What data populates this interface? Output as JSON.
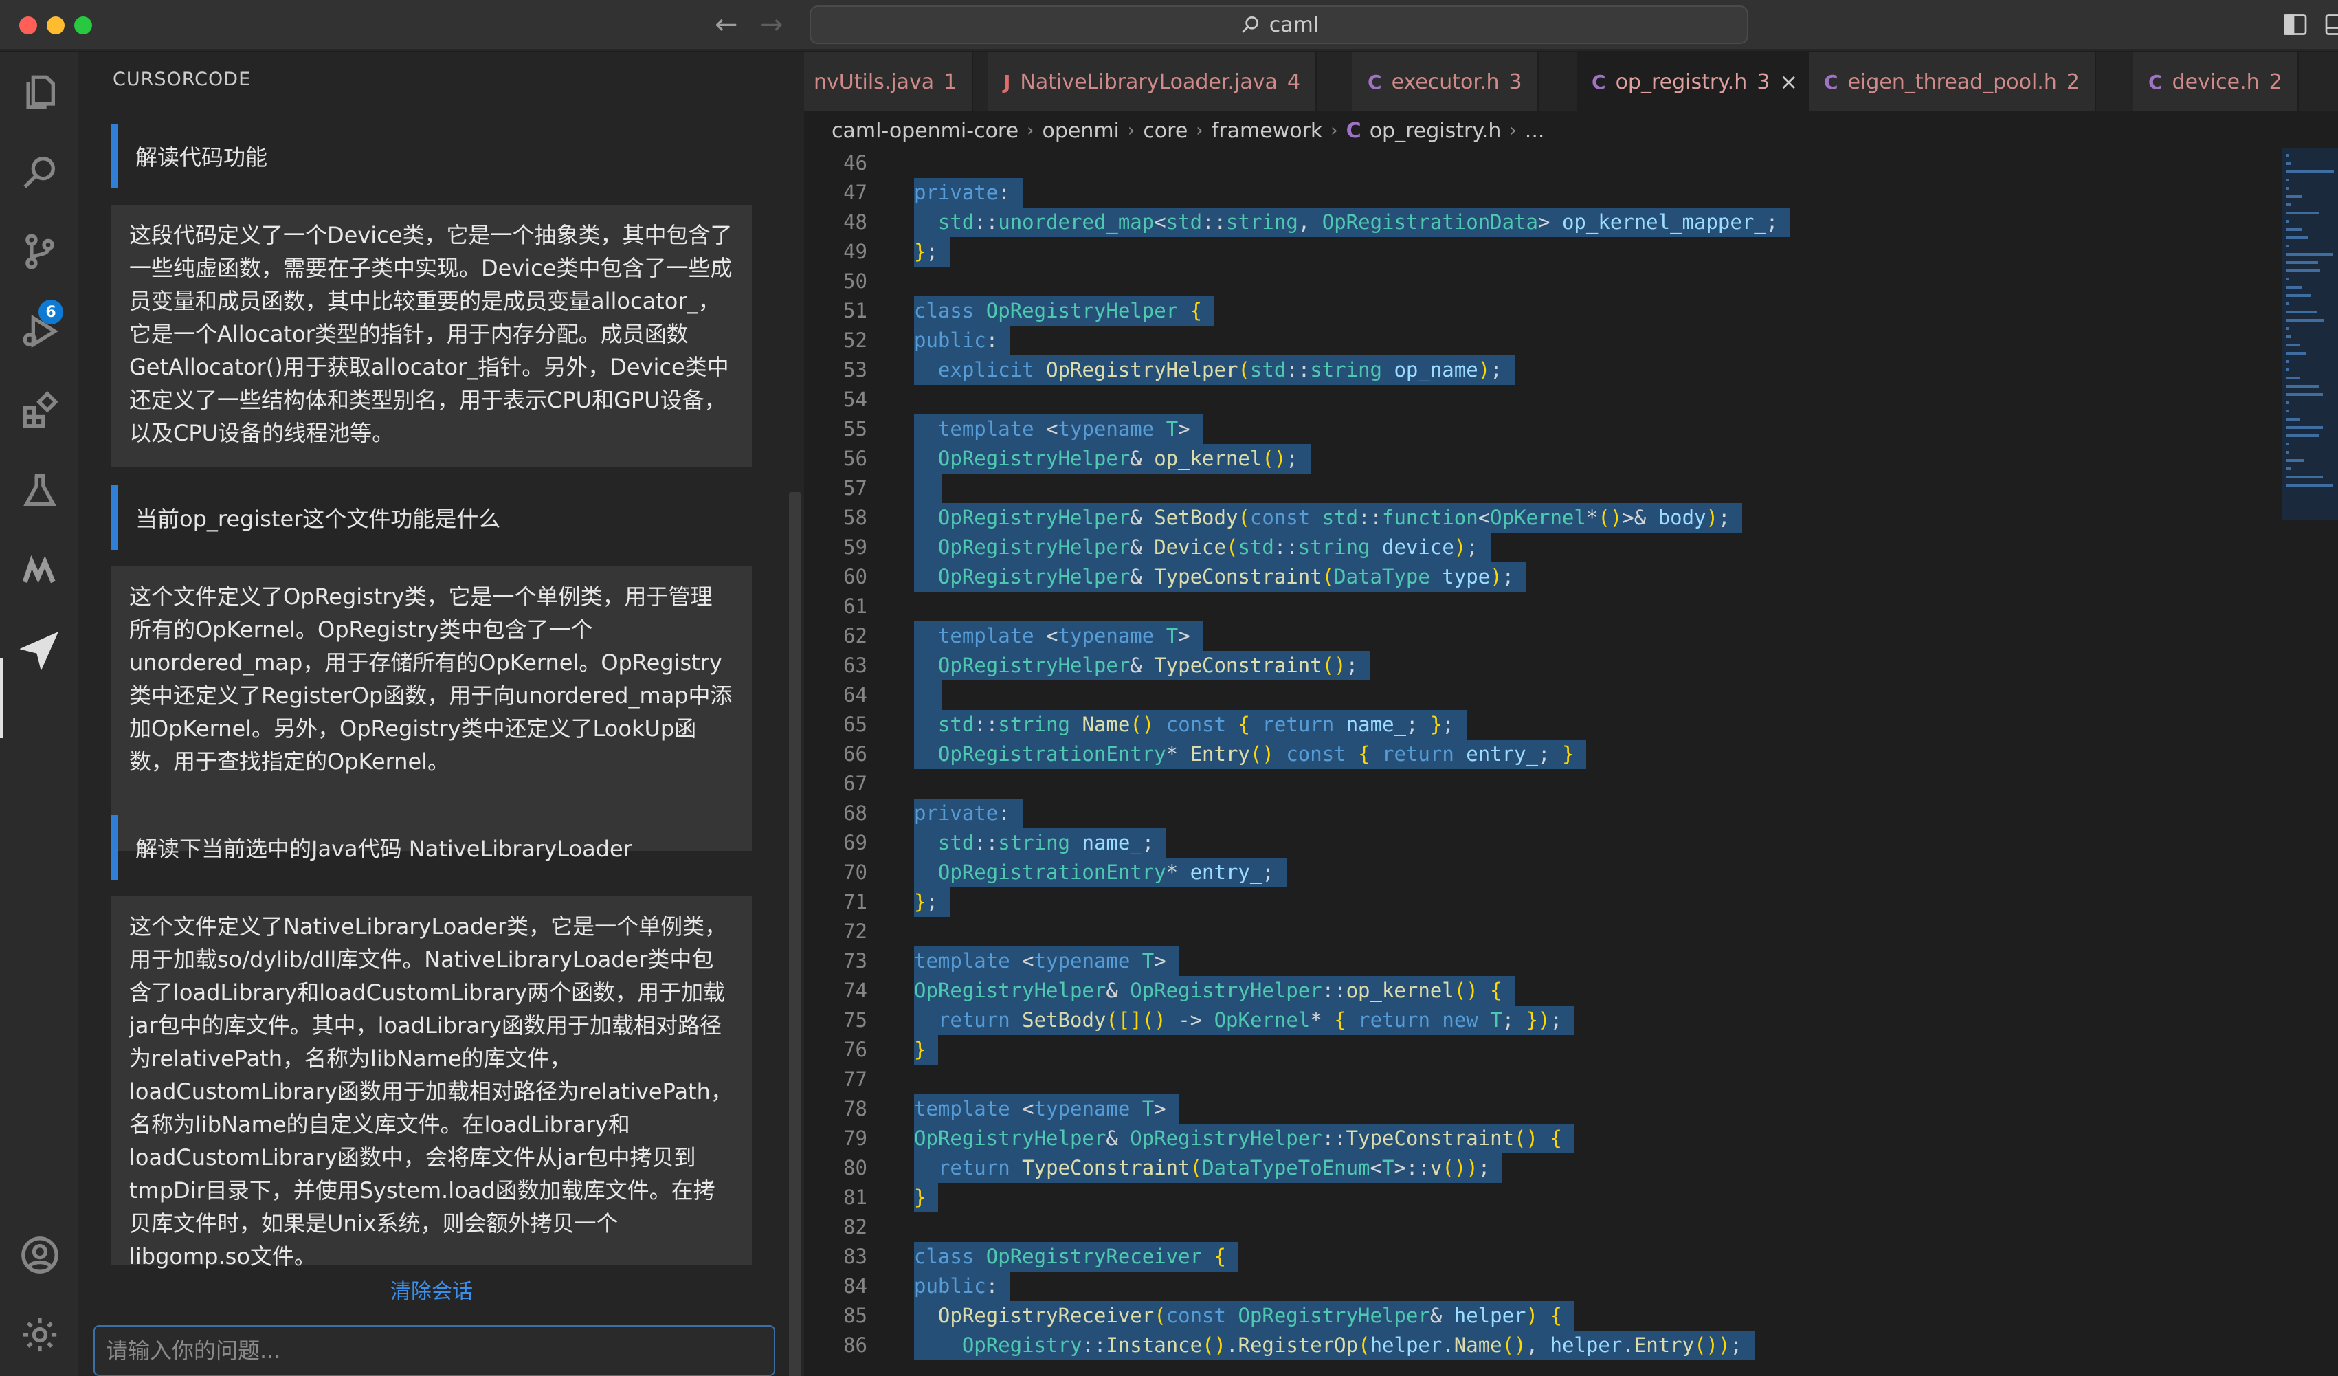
{
  "titlebar": {
    "search_text": "caml"
  },
  "activitybar": {
    "scm_badge": "6"
  },
  "sidebar": {
    "title": "CURSORCODE",
    "conversation": [
      {
        "question": "解读代码功能",
        "answer": "这段代码定义了一个Device类，它是一个抽象类，其中包含了一些纯虚函数，需要在子类中实现。Device类中包含了一些成员变量和成员函数，其中比较重要的是成员变量allocator_，它是一个Allocator类型的指针，用于内存分配。成员函数GetAllocator()用于获取allocator_指针。另外，Device类中还定义了一些结构体和类型别名，用于表示CPU和GPU设备，以及CPU设备的线程池等。"
      },
      {
        "question": "当前op_register这个文件功能是什么",
        "answer": "这个文件定义了OpRegistry类，它是一个单例类，用于管理所有的OpKernel。OpRegistry类中包含了一个unordered_map，用于存储所有的OpKernel。OpRegistry类中还定义了RegisterOp函数，用于向unordered_map中添加OpKernel。另外，OpRegistry类中还定义了LookUp函数，用于查找指定的OpKernel。"
      },
      {
        "question": "解读下当前选中的Java代码 NativeLibraryLoader",
        "answer": "这个文件定义了NativeLibraryLoader类，它是一个单例类，用于加载so/dylib/dll库文件。NativeLibraryLoader类中包含了loadLibrary和loadCustomLibrary两个函数，用于加载jar包中的库文件。其中，loadLibrary函数用于加载相对路径为relativePath，名称为libName的库文件，loadCustomLibrary函数用于加载相对路径为relativePath，名称为libName的自定义库文件。在loadLibrary和loadCustomLibrary函数中，会将库文件从jar包中拷贝到tmpDir目录下，并使用System.load函数加载库文件。在拷贝库文件时，如果是Unix系统，则会额外拷贝一个libgomp.so文件。"
      }
    ],
    "clear_label": "清除会话",
    "input_placeholder": "请输入你的问题..."
  },
  "tabs": [
    {
      "icon": "",
      "name": "nvUtils.java",
      "count": "1"
    },
    {
      "icon": "J",
      "name": "NativeLibraryLoader.java",
      "count": "4"
    },
    {
      "icon": "C",
      "name": "executor.h",
      "count": "3"
    },
    {
      "icon": "C",
      "name": "op_registry.h",
      "count": "3",
      "active": true
    },
    {
      "icon": "C",
      "name": "eigen_thread_pool.h",
      "count": "2"
    },
    {
      "icon": "C",
      "name": "device.h",
      "count": "2"
    }
  ],
  "breadcrumb": [
    "caml-openmi-core",
    "openmi",
    "core",
    "framework",
    "op_registry.h",
    "..."
  ],
  "code": {
    "first_line": 46,
    "lines": [
      "",
      "private:",
      "  std::unordered_map<std::string, OpRegistrationData> op_kernel_mapper_;",
      "};",
      "",
      "class OpRegistryHelper {",
      "public:",
      "  explicit OpRegistryHelper(std::string op_name);",
      "",
      "  template <typename T>",
      "  OpRegistryHelper& op_kernel();",
      "  ",
      "  OpRegistryHelper& SetBody(const std::function<OpKernel*()>& body);",
      "  OpRegistryHelper& Device(std::string device);",
      "  OpRegistryHelper& TypeConstraint(DataType type);",
      "",
      "  template <typename T>",
      "  OpRegistryHelper& TypeConstraint();",
      "  ",
      "  std::string Name() const { return name_; };",
      "  OpRegistrationEntry* Entry() const { return entry_; }",
      "",
      "private:",
      "  std::string name_;",
      "  OpRegistrationEntry* entry_;",
      "};",
      "",
      "template <typename T>",
      "OpRegistryHelper& OpRegistryHelper::op_kernel() {",
      "  return SetBody([]() -> OpKernel* { return new T; });",
      "}",
      "",
      "template <typename T>",
      "OpRegistryHelper& OpRegistryHelper::TypeConstraint() {",
      "  return TypeConstraint(DataTypeToEnum<T>::v());",
      "}",
      "",
      "class OpRegistryReceiver {",
      "public:",
      "  OpRegistryReceiver(const OpRegistryHelper& helper) {",
      "    OpRegistry::Instance().RegisterOp(helper.Name(), helper.Entry());"
    ]
  }
}
